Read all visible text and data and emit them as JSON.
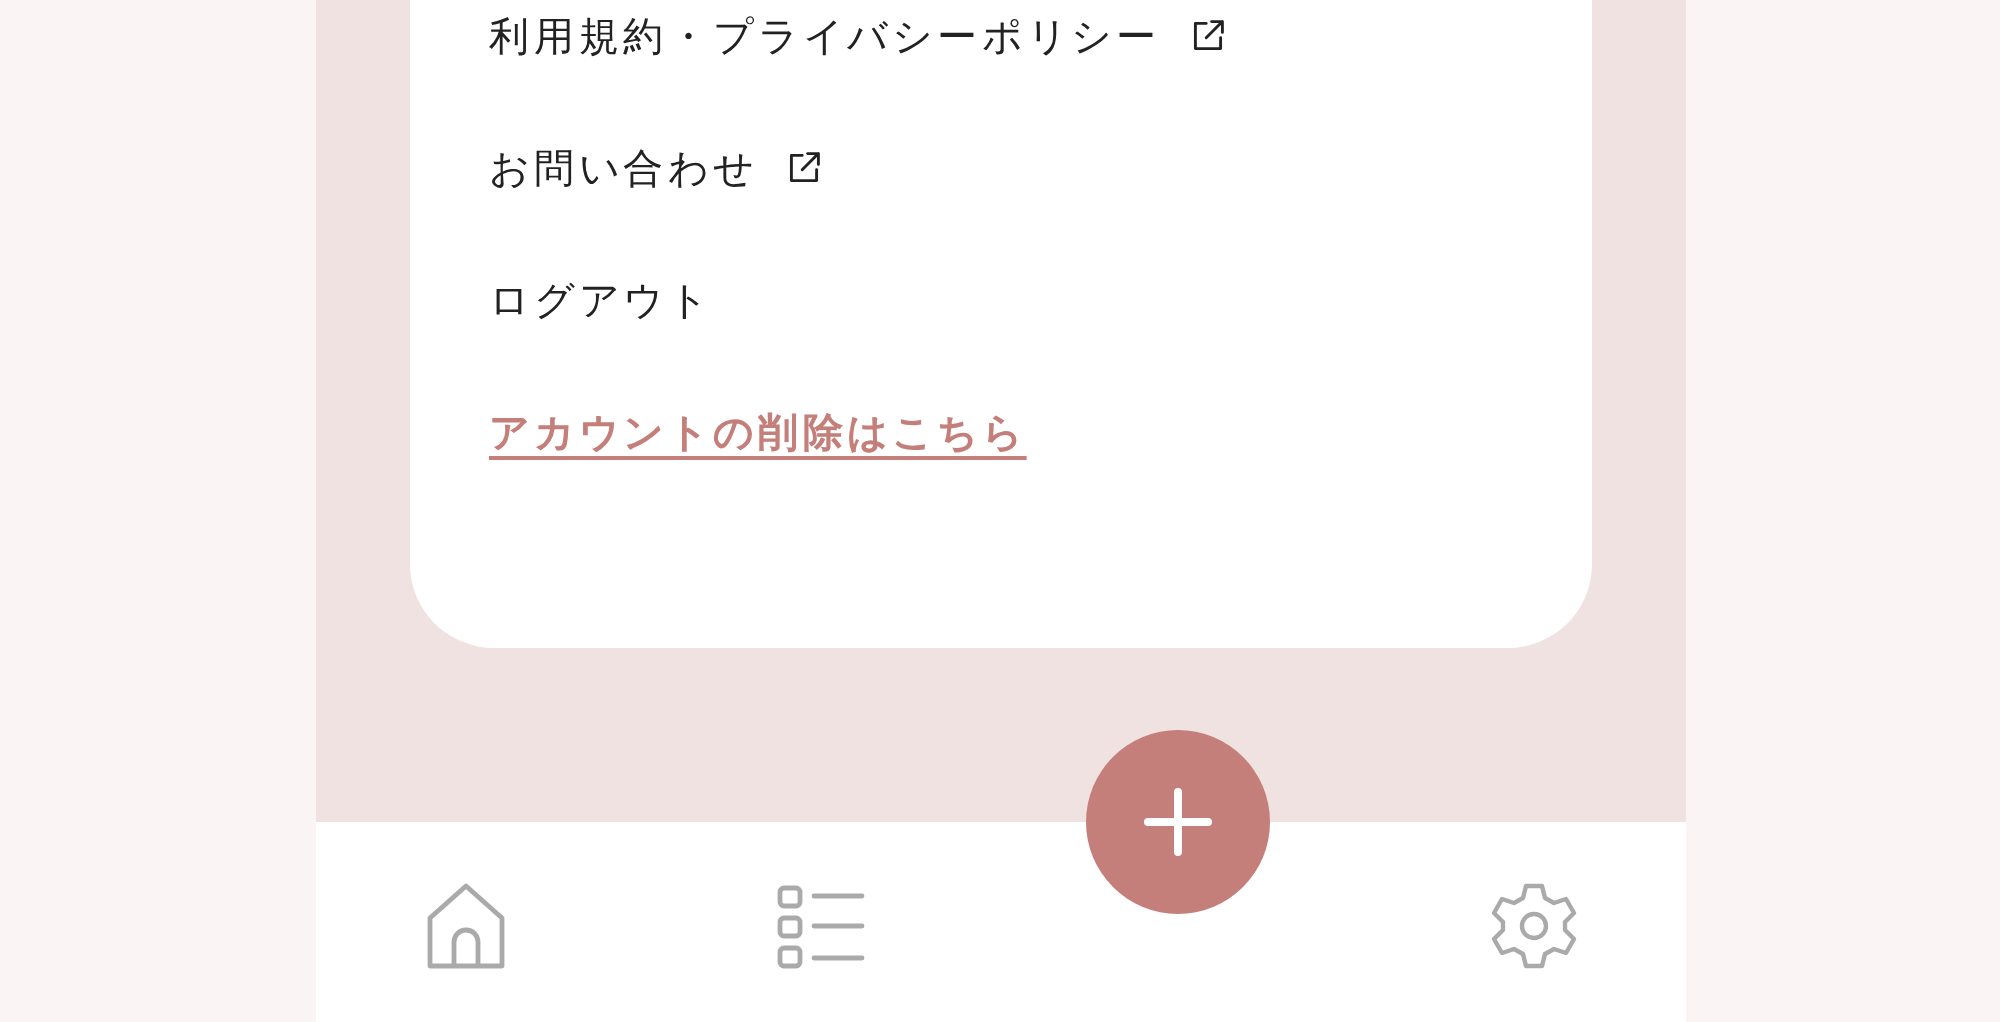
{
  "menu": [
    {
      "label": "利用規約・プライバシーポリシー",
      "kind": "external"
    },
    {
      "label": "お問い合わせ",
      "kind": "external"
    },
    {
      "label": "ログアウト",
      "kind": "plain"
    },
    {
      "label": "アカウントの削除はこちら",
      "kind": "danger"
    }
  ]
}
